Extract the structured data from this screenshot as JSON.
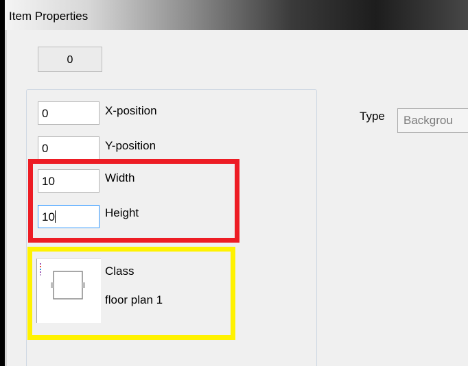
{
  "window": {
    "title": "Item Properties"
  },
  "item": {
    "id_value": "0"
  },
  "position": {
    "x_value": "0",
    "x_label": "X-position",
    "y_value": "0",
    "y_label": "Y-position"
  },
  "size": {
    "width_value": "10",
    "width_label": "Width",
    "height_value": "10",
    "height_label": "Height"
  },
  "class_info": {
    "label": "Class",
    "value": "floor plan 1"
  },
  "type": {
    "label": "Type",
    "selected": "Backgrou"
  },
  "colors": {
    "highlight_red": "#ed1c24",
    "highlight_yellow": "#fff200",
    "focus_blue": "#3399ff"
  }
}
